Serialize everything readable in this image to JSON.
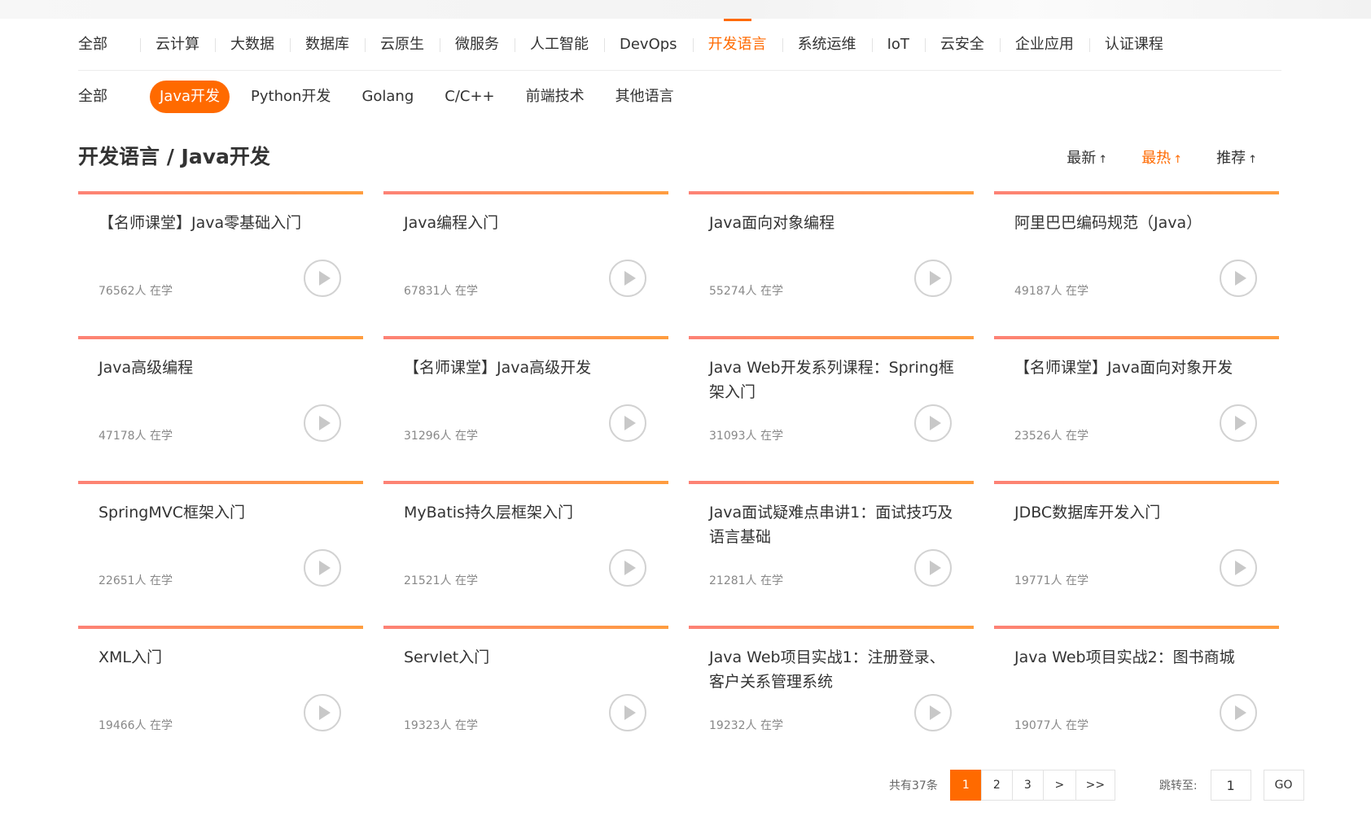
{
  "categories": [
    {
      "label": "全部",
      "active": false
    },
    {
      "label": "云计算",
      "active": false
    },
    {
      "label": "大数据",
      "active": false
    },
    {
      "label": "数据库",
      "active": false
    },
    {
      "label": "云原生",
      "active": false
    },
    {
      "label": "微服务",
      "active": false
    },
    {
      "label": "人工智能",
      "active": false
    },
    {
      "label": "DevOps",
      "active": false
    },
    {
      "label": "开发语言",
      "active": true
    },
    {
      "label": "系统运维",
      "active": false
    },
    {
      "label": "IoT",
      "active": false
    },
    {
      "label": "云安全",
      "active": false
    },
    {
      "label": "企业应用",
      "active": false
    },
    {
      "label": "认证课程",
      "active": false
    }
  ],
  "subcategories": [
    {
      "label": "全部",
      "active": false
    },
    {
      "label": "Java开发",
      "active": true
    },
    {
      "label": "Python开发",
      "active": false
    },
    {
      "label": "Golang",
      "active": false
    },
    {
      "label": "C/C++",
      "active": false
    },
    {
      "label": "前端技术",
      "active": false
    },
    {
      "label": "其他语言",
      "active": false
    }
  ],
  "page_title": "开发语言 / Java开发",
  "sort": [
    {
      "label": "最新",
      "active": false
    },
    {
      "label": "最热",
      "active": true
    },
    {
      "label": "推荐",
      "active": false
    }
  ],
  "sort_arrow": "↑",
  "courses": [
    {
      "title": "【名师课堂】Java零基础入门",
      "count": "76562人 在学"
    },
    {
      "title": "Java编程入门",
      "count": "67831人 在学"
    },
    {
      "title": "Java面向对象编程",
      "count": "55274人 在学"
    },
    {
      "title": "阿里巴巴编码规范（Java）",
      "count": "49187人 在学"
    },
    {
      "title": "Java高级编程",
      "count": "47178人 在学"
    },
    {
      "title": "【名师课堂】Java高级开发",
      "count": "31296人 在学"
    },
    {
      "title": "Java Web开发系列课程：Spring框架入门",
      "count": "31093人 在学"
    },
    {
      "title": "【名师课堂】Java面向对象开发",
      "count": "23526人 在学"
    },
    {
      "title": "SpringMVC框架入门",
      "count": "22651人 在学"
    },
    {
      "title": "MyBatis持久层框架入门",
      "count": "21521人 在学"
    },
    {
      "title": "Java面试疑难点串讲1：面试技巧及语言基础",
      "count": "21281人 在学"
    },
    {
      "title": "JDBC数据库开发入门",
      "count": "19771人 在学"
    },
    {
      "title": "XML入门",
      "count": "19466人 在学"
    },
    {
      "title": "Servlet入门",
      "count": "19323人 在学"
    },
    {
      "title": "Java Web项目实战1：注册登录、客户关系管理系统",
      "count": "19232人 在学"
    },
    {
      "title": "Java Web项目实战2：图书商城",
      "count": "19077人 在学"
    }
  ],
  "pagination": {
    "total": "共有37条",
    "pages": [
      "1",
      "2",
      "3"
    ],
    "current": "1",
    "next": ">",
    "last": ">>",
    "jump_label": "跳转至:",
    "jump_value": "1",
    "go": "GO"
  }
}
